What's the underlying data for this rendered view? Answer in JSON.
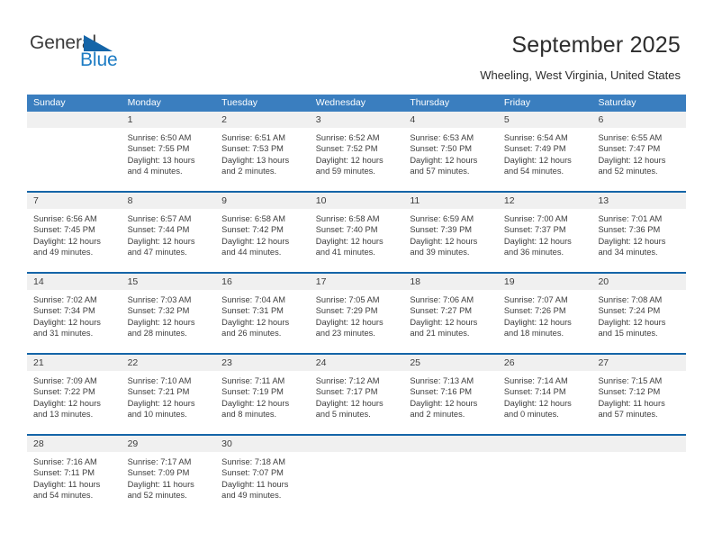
{
  "brand": {
    "name_part1": "General",
    "name_part2": "Blue",
    "triangle_color": "#1565a8",
    "blue_color": "#1d7cc4"
  },
  "header": {
    "title": "September 2025",
    "subtitle": "Wheeling, West Virginia, United States"
  },
  "theme": {
    "header_row_bg": "#3a7ebf",
    "week_divider": "#1565a8",
    "daynum_bg": "#f0f0f0",
    "text": "#3d3d3d"
  },
  "weekdays": [
    "Sunday",
    "Monday",
    "Tuesday",
    "Wednesday",
    "Thursday",
    "Friday",
    "Saturday"
  ],
  "weeks": [
    [
      {
        "empty": true,
        "day": "",
        "sunrise": "",
        "sunset": "",
        "daylight_a": "",
        "daylight_b": ""
      },
      {
        "empty": false,
        "day": "1",
        "sunrise": "Sunrise: 6:50 AM",
        "sunset": "Sunset: 7:55 PM",
        "daylight_a": "Daylight: 13 hours",
        "daylight_b": "and 4 minutes."
      },
      {
        "empty": false,
        "day": "2",
        "sunrise": "Sunrise: 6:51 AM",
        "sunset": "Sunset: 7:53 PM",
        "daylight_a": "Daylight: 13 hours",
        "daylight_b": "and 2 minutes."
      },
      {
        "empty": false,
        "day": "3",
        "sunrise": "Sunrise: 6:52 AM",
        "sunset": "Sunset: 7:52 PM",
        "daylight_a": "Daylight: 12 hours",
        "daylight_b": "and 59 minutes."
      },
      {
        "empty": false,
        "day": "4",
        "sunrise": "Sunrise: 6:53 AM",
        "sunset": "Sunset: 7:50 PM",
        "daylight_a": "Daylight: 12 hours",
        "daylight_b": "and 57 minutes."
      },
      {
        "empty": false,
        "day": "5",
        "sunrise": "Sunrise: 6:54 AM",
        "sunset": "Sunset: 7:49 PM",
        "daylight_a": "Daylight: 12 hours",
        "daylight_b": "and 54 minutes."
      },
      {
        "empty": false,
        "day": "6",
        "sunrise": "Sunrise: 6:55 AM",
        "sunset": "Sunset: 7:47 PM",
        "daylight_a": "Daylight: 12 hours",
        "daylight_b": "and 52 minutes."
      }
    ],
    [
      {
        "empty": false,
        "day": "7",
        "sunrise": "Sunrise: 6:56 AM",
        "sunset": "Sunset: 7:45 PM",
        "daylight_a": "Daylight: 12 hours",
        "daylight_b": "and 49 minutes."
      },
      {
        "empty": false,
        "day": "8",
        "sunrise": "Sunrise: 6:57 AM",
        "sunset": "Sunset: 7:44 PM",
        "daylight_a": "Daylight: 12 hours",
        "daylight_b": "and 47 minutes."
      },
      {
        "empty": false,
        "day": "9",
        "sunrise": "Sunrise: 6:58 AM",
        "sunset": "Sunset: 7:42 PM",
        "daylight_a": "Daylight: 12 hours",
        "daylight_b": "and 44 minutes."
      },
      {
        "empty": false,
        "day": "10",
        "sunrise": "Sunrise: 6:58 AM",
        "sunset": "Sunset: 7:40 PM",
        "daylight_a": "Daylight: 12 hours",
        "daylight_b": "and 41 minutes."
      },
      {
        "empty": false,
        "day": "11",
        "sunrise": "Sunrise: 6:59 AM",
        "sunset": "Sunset: 7:39 PM",
        "daylight_a": "Daylight: 12 hours",
        "daylight_b": "and 39 minutes."
      },
      {
        "empty": false,
        "day": "12",
        "sunrise": "Sunrise: 7:00 AM",
        "sunset": "Sunset: 7:37 PM",
        "daylight_a": "Daylight: 12 hours",
        "daylight_b": "and 36 minutes."
      },
      {
        "empty": false,
        "day": "13",
        "sunrise": "Sunrise: 7:01 AM",
        "sunset": "Sunset: 7:36 PM",
        "daylight_a": "Daylight: 12 hours",
        "daylight_b": "and 34 minutes."
      }
    ],
    [
      {
        "empty": false,
        "day": "14",
        "sunrise": "Sunrise: 7:02 AM",
        "sunset": "Sunset: 7:34 PM",
        "daylight_a": "Daylight: 12 hours",
        "daylight_b": "and 31 minutes."
      },
      {
        "empty": false,
        "day": "15",
        "sunrise": "Sunrise: 7:03 AM",
        "sunset": "Sunset: 7:32 PM",
        "daylight_a": "Daylight: 12 hours",
        "daylight_b": "and 28 minutes."
      },
      {
        "empty": false,
        "day": "16",
        "sunrise": "Sunrise: 7:04 AM",
        "sunset": "Sunset: 7:31 PM",
        "daylight_a": "Daylight: 12 hours",
        "daylight_b": "and 26 minutes."
      },
      {
        "empty": false,
        "day": "17",
        "sunrise": "Sunrise: 7:05 AM",
        "sunset": "Sunset: 7:29 PM",
        "daylight_a": "Daylight: 12 hours",
        "daylight_b": "and 23 minutes."
      },
      {
        "empty": false,
        "day": "18",
        "sunrise": "Sunrise: 7:06 AM",
        "sunset": "Sunset: 7:27 PM",
        "daylight_a": "Daylight: 12 hours",
        "daylight_b": "and 21 minutes."
      },
      {
        "empty": false,
        "day": "19",
        "sunrise": "Sunrise: 7:07 AM",
        "sunset": "Sunset: 7:26 PM",
        "daylight_a": "Daylight: 12 hours",
        "daylight_b": "and 18 minutes."
      },
      {
        "empty": false,
        "day": "20",
        "sunrise": "Sunrise: 7:08 AM",
        "sunset": "Sunset: 7:24 PM",
        "daylight_a": "Daylight: 12 hours",
        "daylight_b": "and 15 minutes."
      }
    ],
    [
      {
        "empty": false,
        "day": "21",
        "sunrise": "Sunrise: 7:09 AM",
        "sunset": "Sunset: 7:22 PM",
        "daylight_a": "Daylight: 12 hours",
        "daylight_b": "and 13 minutes."
      },
      {
        "empty": false,
        "day": "22",
        "sunrise": "Sunrise: 7:10 AM",
        "sunset": "Sunset: 7:21 PM",
        "daylight_a": "Daylight: 12 hours",
        "daylight_b": "and 10 minutes."
      },
      {
        "empty": false,
        "day": "23",
        "sunrise": "Sunrise: 7:11 AM",
        "sunset": "Sunset: 7:19 PM",
        "daylight_a": "Daylight: 12 hours",
        "daylight_b": "and 8 minutes."
      },
      {
        "empty": false,
        "day": "24",
        "sunrise": "Sunrise: 7:12 AM",
        "sunset": "Sunset: 7:17 PM",
        "daylight_a": "Daylight: 12 hours",
        "daylight_b": "and 5 minutes."
      },
      {
        "empty": false,
        "day": "25",
        "sunrise": "Sunrise: 7:13 AM",
        "sunset": "Sunset: 7:16 PM",
        "daylight_a": "Daylight: 12 hours",
        "daylight_b": "and 2 minutes."
      },
      {
        "empty": false,
        "day": "26",
        "sunrise": "Sunrise: 7:14 AM",
        "sunset": "Sunset: 7:14 PM",
        "daylight_a": "Daylight: 12 hours",
        "daylight_b": "and 0 minutes."
      },
      {
        "empty": false,
        "day": "27",
        "sunrise": "Sunrise: 7:15 AM",
        "sunset": "Sunset: 7:12 PM",
        "daylight_a": "Daylight: 11 hours",
        "daylight_b": "and 57 minutes."
      }
    ],
    [
      {
        "empty": false,
        "day": "28",
        "sunrise": "Sunrise: 7:16 AM",
        "sunset": "Sunset: 7:11 PM",
        "daylight_a": "Daylight: 11 hours",
        "daylight_b": "and 54 minutes."
      },
      {
        "empty": false,
        "day": "29",
        "sunrise": "Sunrise: 7:17 AM",
        "sunset": "Sunset: 7:09 PM",
        "daylight_a": "Daylight: 11 hours",
        "daylight_b": "and 52 minutes."
      },
      {
        "empty": false,
        "day": "30",
        "sunrise": "Sunrise: 7:18 AM",
        "sunset": "Sunset: 7:07 PM",
        "daylight_a": "Daylight: 11 hours",
        "daylight_b": "and 49 minutes."
      },
      {
        "empty": true,
        "day": "",
        "sunrise": "",
        "sunset": "",
        "daylight_a": "",
        "daylight_b": ""
      },
      {
        "empty": true,
        "day": "",
        "sunrise": "",
        "sunset": "",
        "daylight_a": "",
        "daylight_b": ""
      },
      {
        "empty": true,
        "day": "",
        "sunrise": "",
        "sunset": "",
        "daylight_a": "",
        "daylight_b": ""
      },
      {
        "empty": true,
        "day": "",
        "sunrise": "",
        "sunset": "",
        "daylight_a": "",
        "daylight_b": ""
      }
    ]
  ]
}
